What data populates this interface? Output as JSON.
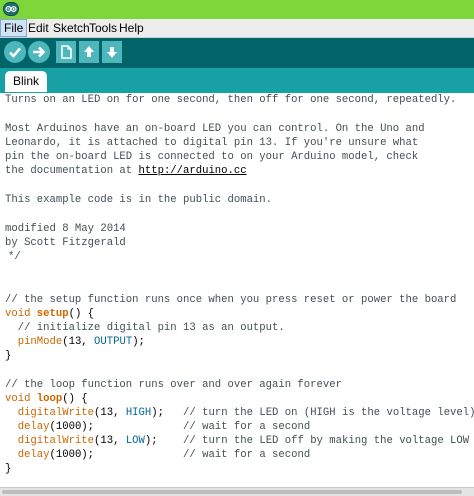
{
  "menu": {
    "file": "File",
    "edit": "Edit",
    "sketch": "Sketch",
    "tools": "Tools",
    "help": "Help"
  },
  "toolbar": {
    "buttons": [
      "verify",
      "upload",
      "new",
      "open",
      "save"
    ]
  },
  "tab": {
    "label": "Blink"
  },
  "code": {
    "l1": "Turns on an LED on for one second, then off for one second, repeatedly.",
    "l2": "Most Arduinos have an on-board LED you can control. On the Uno and",
    "l3": "Leonardo, it is attached to digital pin 13. If you're unsure what",
    "l4": "pin the on-board LED is connected to on your Arduino model, check",
    "l5a": "the documentation at ",
    "l5b": "http://arduino.cc",
    "l6": "This example code is in the public domain.",
    "l7": "modified 8 May 2014",
    "l8": "by Scott Fitzgerald",
    "l9": "*/",
    "setup_comment": "// the setup function runs once when you press reset or power the board",
    "setup_void": "void",
    "setup_name": "setup",
    "setup_rest": "() {",
    "setup_c1": "  // initialize digital pin 13 as an output.",
    "pm_ind": "  ",
    "pm_fn": "pinMode",
    "pm_a": "(13, ",
    "pm_c": "OUTPUT",
    "pm_b": ");",
    "close1": "}",
    "loop_comment": "// the loop function runs over and over again forever",
    "loop_void": "void",
    "loop_name": "loop",
    "loop_rest": "() {",
    "dw1_ind": "  ",
    "dw1_fn": "digitalWrite",
    "dw1_a": "(13, ",
    "dw1_c": "HIGH",
    "dw1_b": ");   ",
    "dw1_cm": "// turn the LED on (HIGH is the voltage level)",
    "d1_ind": "  ",
    "d1_fn": "delay",
    "d1_a": "(1000);              ",
    "d1_cm": "// wait for a second",
    "dw2_ind": "  ",
    "dw2_fn": "digitalWrite",
    "dw2_a": "(13, ",
    "dw2_c": "LOW",
    "dw2_b": ");    ",
    "dw2_cm": "// turn the LED off by making the voltage LOW",
    "d2_ind": "  ",
    "d2_fn": "delay",
    "d2_a": "(1000);              ",
    "d2_cm": "// wait for a second",
    "close2": "}"
  }
}
